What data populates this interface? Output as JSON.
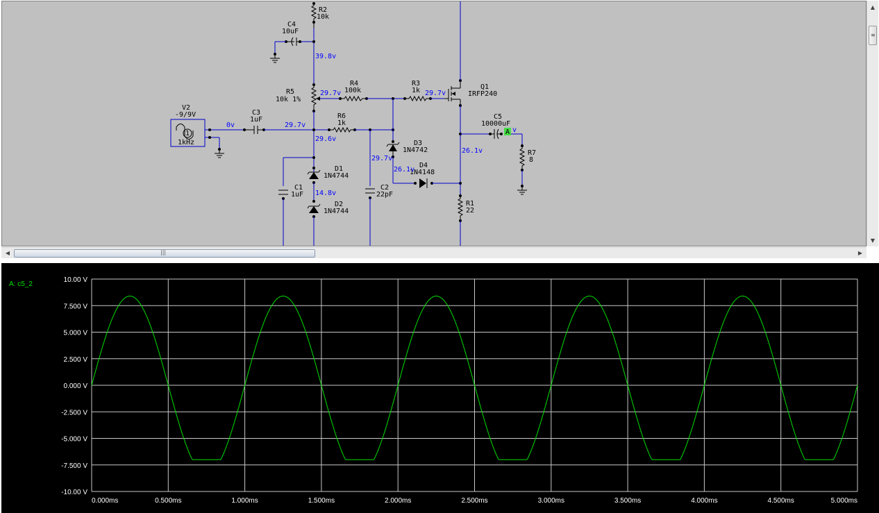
{
  "schematic": {
    "components": [
      {
        "ref": "R2",
        "value": "10k"
      },
      {
        "ref": "C4",
        "value": "10uF"
      },
      {
        "ref": "R5",
        "value": "10k 1%"
      },
      {
        "ref": "R4",
        "value": "100k"
      },
      {
        "ref": "R3",
        "value": "1k"
      },
      {
        "ref": "Q1",
        "value": "IRFP240"
      },
      {
        "ref": "V2",
        "value": "-9/9V"
      },
      {
        "ref": "V2 freq",
        "value": "1kHz"
      },
      {
        "ref": "C3",
        "value": "1uF"
      },
      {
        "ref": "R6",
        "value": "1k"
      },
      {
        "ref": "C5",
        "value": "10000uF"
      },
      {
        "ref": "D3",
        "value": "1N4742"
      },
      {
        "ref": "R7",
        "value": "8"
      },
      {
        "ref": "D1",
        "value": "1N4744"
      },
      {
        "ref": "D4",
        "value": "1N4148"
      },
      {
        "ref": "C1",
        "value": "1uF"
      },
      {
        "ref": "C2",
        "value": "22pF"
      },
      {
        "ref": "D2",
        "value": "1N4744"
      },
      {
        "ref": "R1",
        "value": "22"
      }
    ],
    "source_symbol": "1",
    "probe_tag": "A",
    "voltages": [
      "39.8v",
      "29.7v",
      "29.7v",
      "0v",
      "29.7v",
      "29.6v",
      "29.7v",
      "26.1v",
      "26.1v",
      "14.8v",
      "v"
    ]
  },
  "scope": {
    "probe_label": "A: c5_2",
    "trace_color": "#00e000",
    "y_ticks": [
      "10.00 V",
      "7.500 V",
      "5.000 V",
      "2.500 V",
      "0.000 V",
      "-2.500 V",
      "-5.000 V",
      "-7.500 V",
      "-10.00 V"
    ],
    "x_ticks": [
      "0.000ms",
      "0.500ms",
      "1.000ms",
      "1.500ms",
      "2.000ms",
      "2.500ms",
      "3.000ms",
      "3.500ms",
      "4.000ms",
      "4.500ms",
      "5.000ms"
    ]
  },
  "chart_data": {
    "type": "line",
    "series": [
      {
        "name": "A: c5_2",
        "freq_khz": 1,
        "peak": 8.4,
        "trough": -7.0
      }
    ],
    "xlim": [
      0,
      5
    ],
    "ylim": [
      -10,
      10
    ],
    "grid": true
  }
}
